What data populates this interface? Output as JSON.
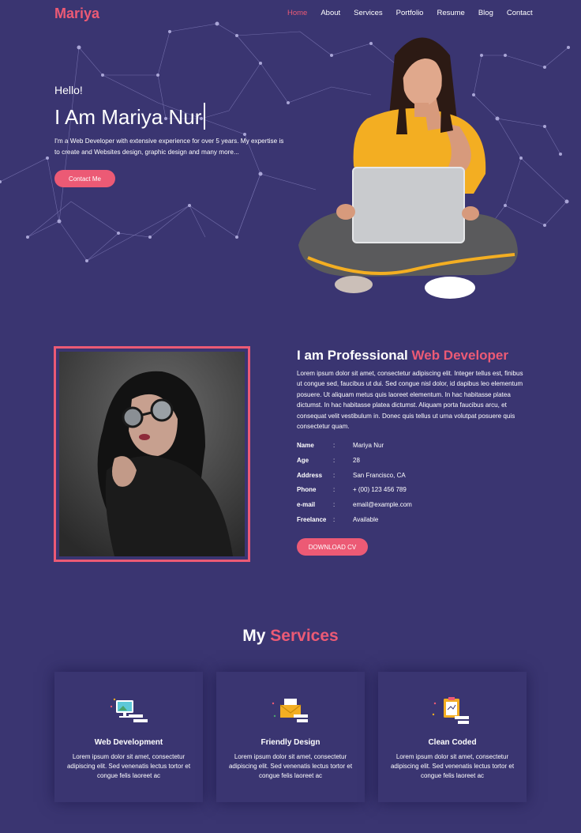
{
  "header": {
    "logo": "Mariya",
    "nav": [
      {
        "label": "Home",
        "active": true
      },
      {
        "label": "About",
        "active": false
      },
      {
        "label": "Services",
        "active": false
      },
      {
        "label": "Portfolio",
        "active": false
      },
      {
        "label": "Resume",
        "active": false
      },
      {
        "label": "Blog",
        "active": false
      },
      {
        "label": "Contact",
        "active": false
      }
    ]
  },
  "hero": {
    "greeting": "Hello!",
    "title": "I Am Mariya Nur",
    "description": "I'm a Web Developer with extensive experience for over 5 years. My expertise is to create and Websites design, graphic design and many more...",
    "button": "Contact Me"
  },
  "about": {
    "title_prefix": "I am Professional ",
    "title_accent": "Web Developer",
    "text": "Lorem ipsum dolor sit amet, consectetur adipiscing elit. Integer tellus est, finibus ut congue sed, faucibus ut dui. Sed congue nisl dolor, id dapibus leo elementum posuere. Ut aliquam metus quis laoreet elementum. In hac habitasse platea dictumst. In hac habitasse platea dictumst. Aliquam porta faucibus arcu, et consequat velit vestibulum in. Donec quis tellus ut urna volutpat posuere quis consectetur quam.",
    "info": [
      {
        "label": "Name",
        "value": "Mariya Nur"
      },
      {
        "label": "Age",
        "value": "28"
      },
      {
        "label": "Address",
        "value": "San Francisco, CA"
      },
      {
        "label": "Phone",
        "value": "+ (00) 123 456 789"
      },
      {
        "label": "e-mail",
        "value": "email@example.com"
      },
      {
        "label": "Freelance",
        "value": "Available"
      }
    ],
    "separator": ":",
    "button": "DOWNLOAD CV"
  },
  "services": {
    "title_prefix": "My ",
    "title_accent": "Services",
    "cards": [
      {
        "icon": "monitor-icon",
        "title": "Web Development",
        "text": "Lorem ipsum dolor sit amet, consectetur adipiscing elit. Sed venenatis lectus tortor et congue felis laoreet ac"
      },
      {
        "icon": "envelope-icon",
        "title": "Friendly Design",
        "text": "Lorem ipsum dolor sit amet, consectetur adipiscing elit. Sed venenatis lectus tortor et congue felis laoreet ac"
      },
      {
        "icon": "clipboard-icon",
        "title": "Clean Coded",
        "text": "Lorem ipsum dolor sit amet, consectetur adipiscing elit. Sed venenatis lectus tortor et congue felis laoreet ac"
      }
    ]
  },
  "colors": {
    "background": "#3a3571",
    "accent": "#ec5a75"
  }
}
